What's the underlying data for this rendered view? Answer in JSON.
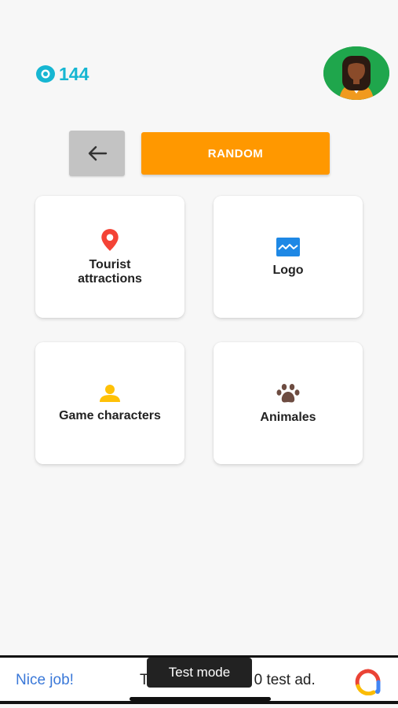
{
  "header": {
    "coin_count": "144",
    "coin_icon": "eye-coin-icon",
    "avatar_icon": "user-avatar-icon"
  },
  "controls": {
    "back_icon": "arrow-left-icon",
    "random_label": "RANDOM"
  },
  "categories": [
    {
      "label": "Tourist\nattractions",
      "icon": "location-pin-icon",
      "color": "#f44336"
    },
    {
      "label": "Logo",
      "icon": "image-icon",
      "color": "#1e88e5"
    },
    {
      "label": "Game characters",
      "icon": "person-icon",
      "color": "#ffc107"
    },
    {
      "label": "Animales",
      "icon": "paw-icon",
      "color": "#6d4c41"
    }
  ],
  "ad": {
    "nice_job": "Nice job!",
    "text_left": "T",
    "text_right": "0 test ad.",
    "toast": "Test mode"
  },
  "colors": {
    "accent": "#ff9800",
    "coin": "#16b6d2",
    "avatar_bg": "#1fa64c"
  }
}
